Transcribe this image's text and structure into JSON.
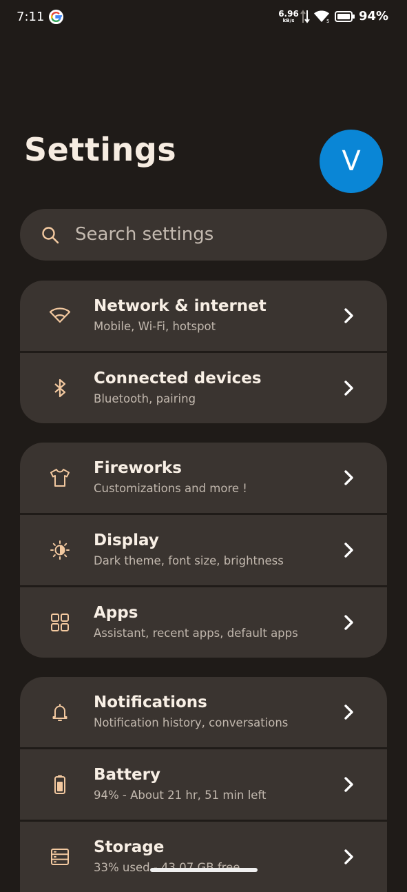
{
  "status_bar": {
    "time": "7:11",
    "net_speed_value": "6.96",
    "net_speed_unit": "kB/s",
    "battery_percent": "94%"
  },
  "header": {
    "title": "Settings",
    "avatar_letter": "V"
  },
  "search": {
    "placeholder": "Search settings"
  },
  "groups": [
    {
      "items": [
        {
          "title": "Network & internet",
          "subtitle": "Mobile, Wi-Fi, hotspot",
          "icon": "wifi-icon"
        },
        {
          "title": "Connected devices",
          "subtitle": "Bluetooth, pairing",
          "icon": "bluetooth-icon"
        }
      ]
    },
    {
      "items": [
        {
          "title": "Fireworks",
          "subtitle": "Customizations and more !",
          "icon": "tshirt-icon"
        },
        {
          "title": "Display",
          "subtitle": "Dark theme, font size, brightness",
          "icon": "brightness-icon"
        },
        {
          "title": "Apps",
          "subtitle": "Assistant, recent apps, default apps",
          "icon": "apps-grid-icon"
        }
      ]
    },
    {
      "items": [
        {
          "title": "Notifications",
          "subtitle": "Notification history, conversations",
          "icon": "bell-icon"
        },
        {
          "title": "Battery",
          "subtitle": "94% - About 21 hr, 51 min left",
          "icon": "battery-icon"
        },
        {
          "title": "Storage",
          "subtitle": "33% used - 43.07 GB free",
          "icon": "storage-icon"
        }
      ]
    }
  ],
  "colors": {
    "background": "#1f1b18",
    "card": "#3a3430",
    "accent_icon": "#f3c9a0",
    "avatar": "#0a86d6"
  }
}
